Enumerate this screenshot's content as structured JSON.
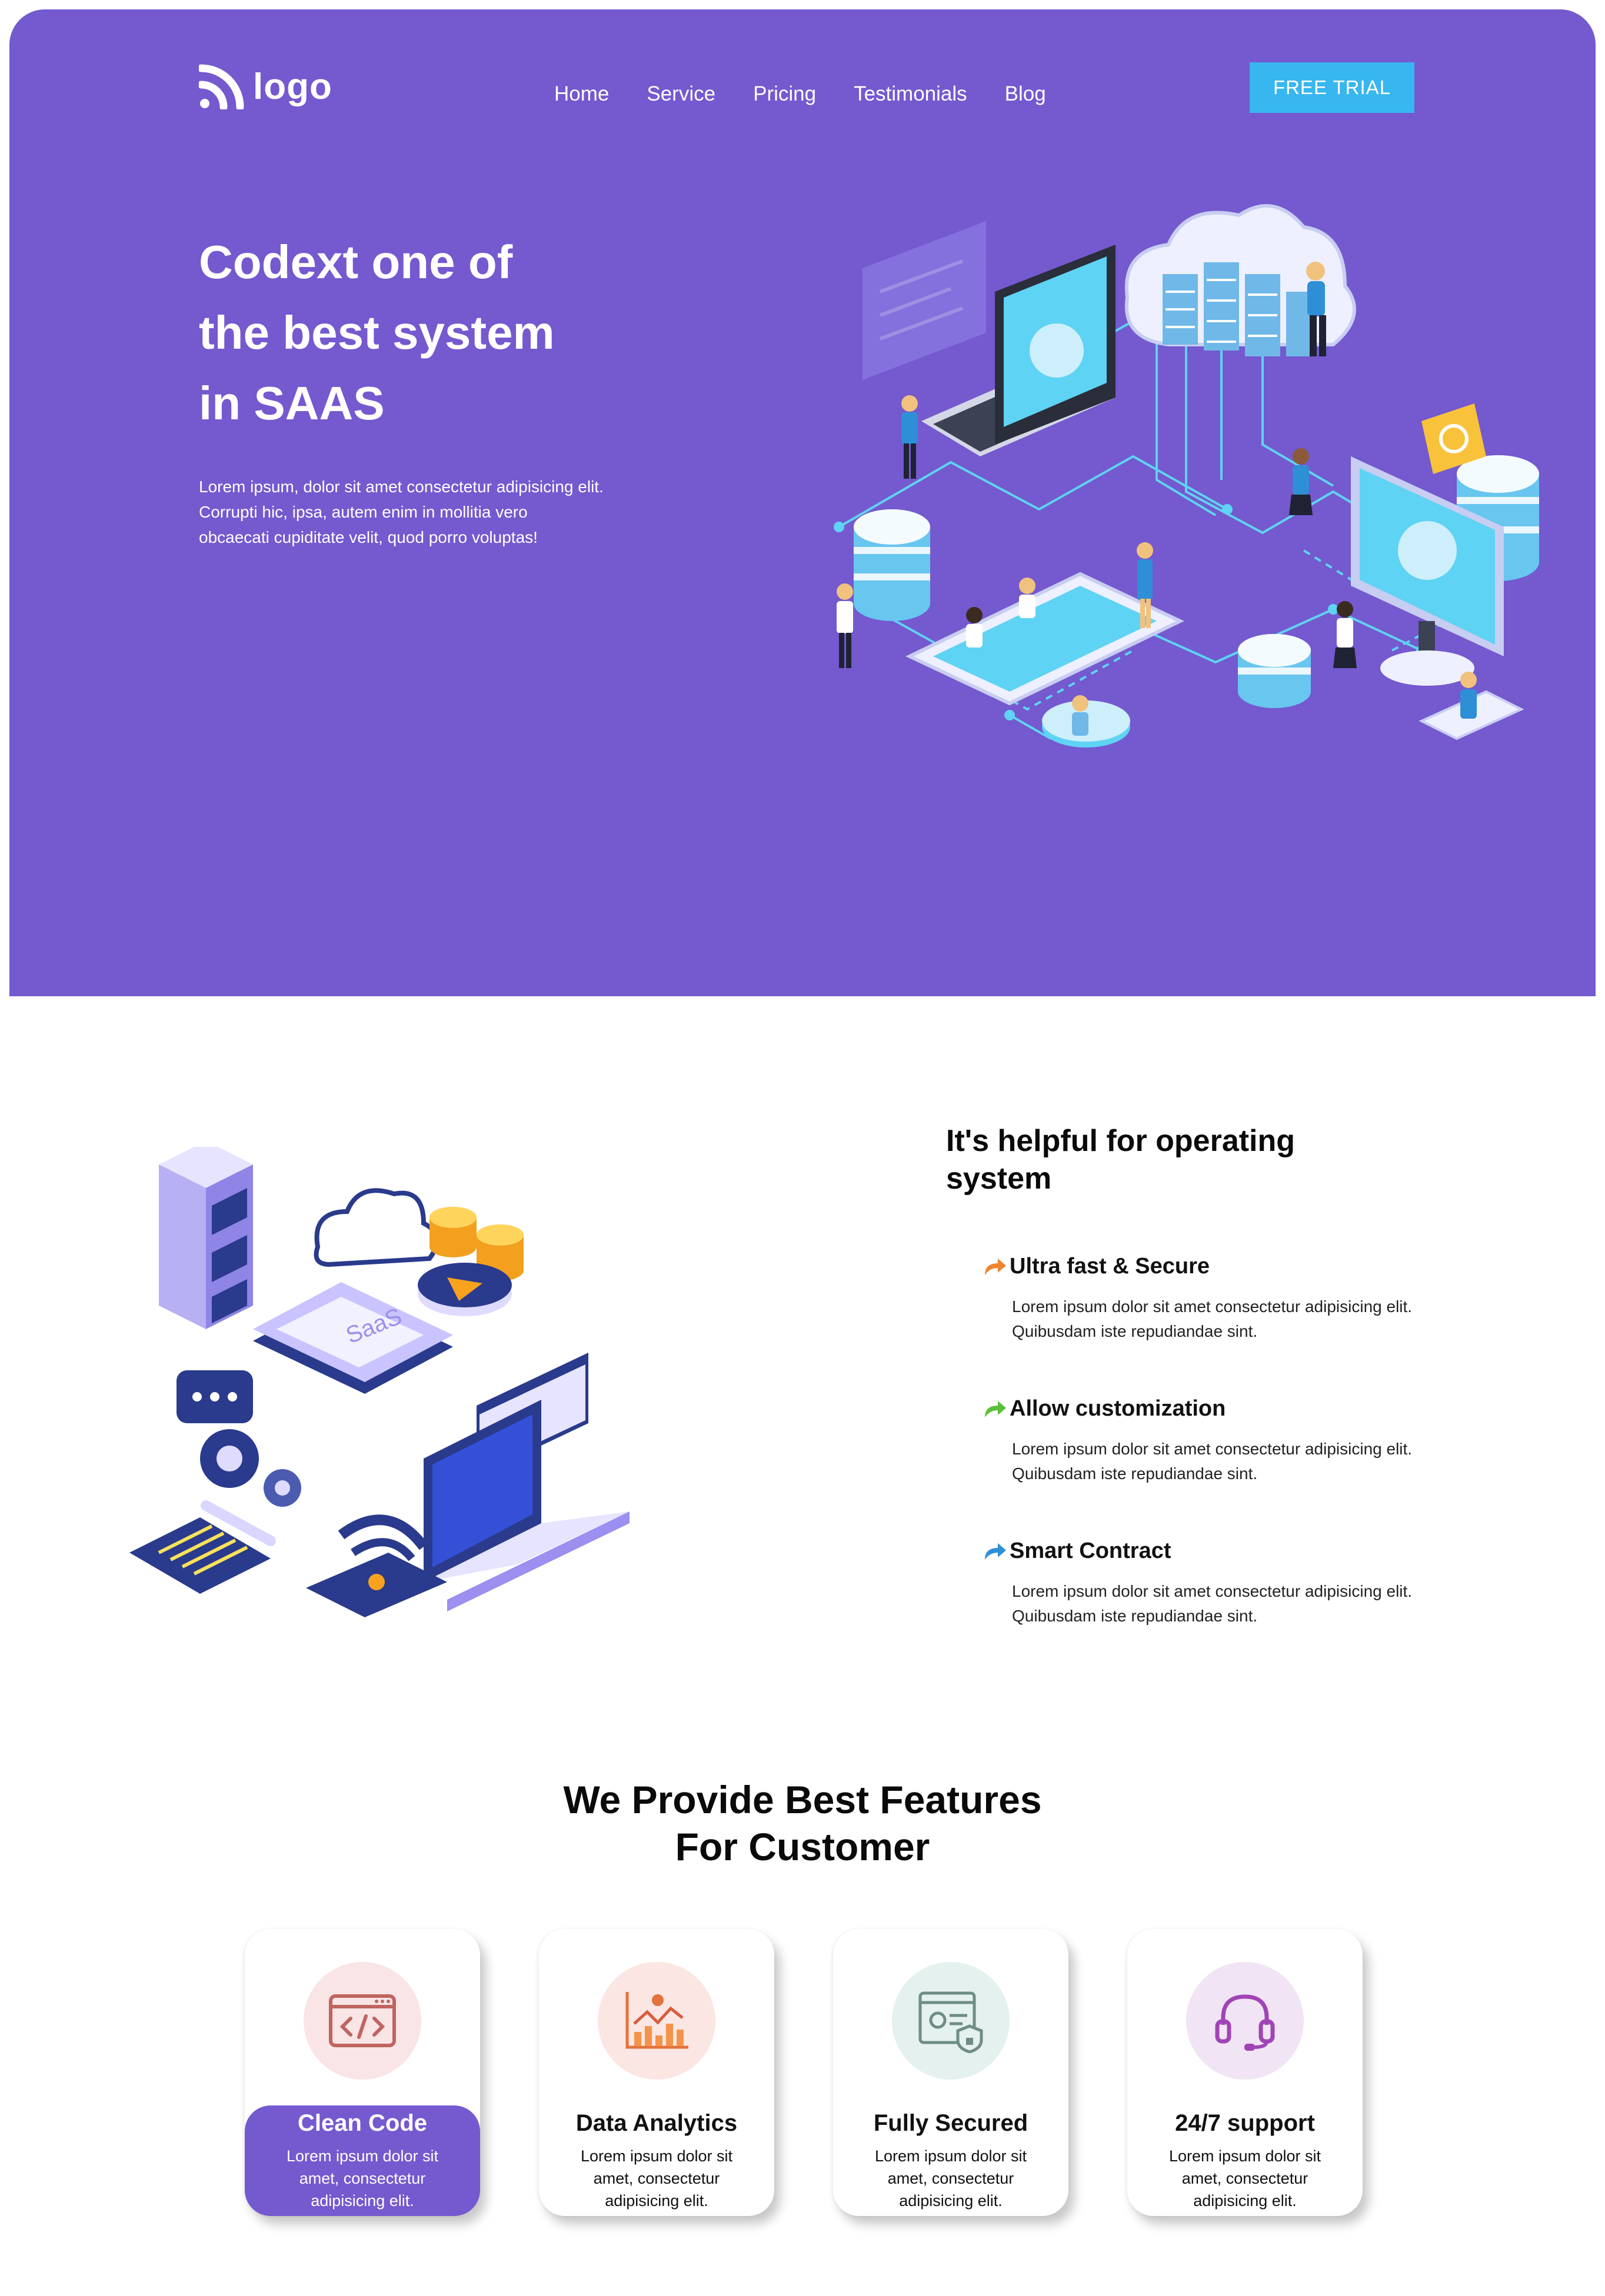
{
  "header": {
    "logo_text": "logo",
    "nav": [
      "Home",
      "Service",
      "Pricing",
      "Testimonials",
      "Blog"
    ],
    "cta": "FREE TRIAL"
  },
  "hero": {
    "title_lines": [
      "Codext one of",
      "the best system",
      "in SAAS"
    ],
    "subtitle_lines": [
      "Lorem ipsum, dolor sit amet consectetur adipisicing elit.",
      "Corrupti hic, ipsa, autem enim in mollitia vero",
      "obcaecati cupiditate velit, quod porro voluptas!"
    ]
  },
  "helpful": {
    "title_lines": [
      "It's helpful for operating",
      "system"
    ],
    "features": [
      {
        "title": "Ultra fast & Secure",
        "icon": "share-arrow-icon",
        "color": "#f2842f",
        "desc_lines": [
          "Lorem ipsum dolor sit amet consectetur adipisicing elit.",
          "Quibusdam iste repudiandae sint."
        ]
      },
      {
        "title": "Allow customization",
        "icon": "share-arrow-icon",
        "color": "#5cbf3a",
        "desc_lines": [
          "Lorem ipsum dolor sit amet consectetur adipisicing elit.",
          "Quibusdam iste repudiandae sint."
        ]
      },
      {
        "title": "Smart Contract",
        "icon": "share-arrow-icon",
        "color": "#2e8fd6",
        "desc_lines": [
          "Lorem ipsum dolor sit amet consectetur adipisicing elit.",
          "Quibusdam iste repudiandae sint."
        ]
      }
    ],
    "illustration_text": "SaaS"
  },
  "best": {
    "title_lines": [
      "We Provide Best Features",
      "For Customer"
    ],
    "cards": [
      {
        "title": "Clean Code",
        "icon": "code-window-icon",
        "active": true,
        "desc_lines": [
          "Lorem ipsum dolor sit",
          "amet, consectetur",
          "adipisicing elit."
        ]
      },
      {
        "title": "Data Analytics",
        "icon": "analytics-chart-icon",
        "active": false,
        "desc_lines": [
          "Lorem ipsum dolor sit",
          "amet, consectetur",
          "adipisicing elit."
        ]
      },
      {
        "title": "Fully Secured",
        "icon": "secure-profile-icon",
        "active": false,
        "desc_lines": [
          "Lorem ipsum dolor sit",
          "amet, consectetur",
          "adipisicing elit."
        ]
      },
      {
        "title": "24/7 support",
        "icon": "headset-icon",
        "active": false,
        "desc_lines": [
          "Lorem ipsum dolor sit",
          "amet, consectetur",
          "adipisicing elit."
        ]
      }
    ]
  },
  "colors": {
    "primary": "#7459cf",
    "cta": "#38b6ef",
    "accent_orange": "#f2842f",
    "accent_green": "#5cbf3a",
    "accent_blue": "#2e8fd6"
  }
}
